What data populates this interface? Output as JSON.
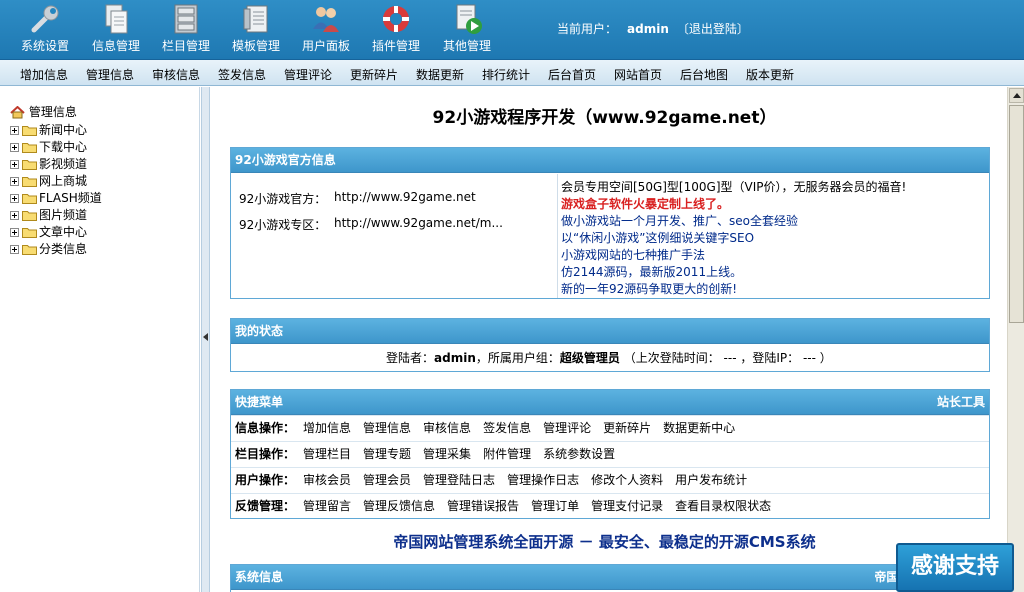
{
  "top_nav": {
    "items": [
      {
        "label": "系统设置",
        "icon": "wrench-icon"
      },
      {
        "label": "信息管理",
        "icon": "documents-icon"
      },
      {
        "label": "栏目管理",
        "icon": "cabinet-icon"
      },
      {
        "label": "模板管理",
        "icon": "template-icon"
      },
      {
        "label": "用户面板",
        "icon": "users-icon"
      },
      {
        "label": "插件管理",
        "icon": "lifebuoy-icon"
      },
      {
        "label": "其他管理",
        "icon": "play-document-icon"
      }
    ],
    "current_user_label": "当前用户：",
    "username": "admin",
    "logout": "〔退出登陆〕"
  },
  "sub_nav": [
    "增加信息",
    "管理信息",
    "审核信息",
    "签发信息",
    "管理评论",
    "更新碎片",
    "数据更新",
    "排行统计",
    "后台首页",
    "网站首页",
    "后台地图",
    "版本更新"
  ],
  "tree": {
    "root": "管理信息",
    "nodes": [
      "新闻中心",
      "下载中心",
      "影视频道",
      "网上商城",
      "FLASH频道",
      "图片频道",
      "文章中心",
      "分类信息"
    ]
  },
  "main": {
    "page_title": "92小游戏程序开发（www.92game.net）",
    "official": {
      "header": "92小游戏官方信息",
      "site_label": "92小游戏官方：",
      "site_url": "http://www.92game.net",
      "zone_label": "92小游戏专区：",
      "zone_url": "http://www.92game.net/m...",
      "news": [
        "会员专用空间[50G]型[100G]型（VIP价），无服务器会员的福音!",
        "游戏盒子软件火暴定制上线了。",
        "做小游戏站一个月开发、推广、seo全套经验",
        "以“休闲小游戏”这例细说关键字SEO",
        "小游戏网站的七种推广手法",
        "仿2144源码，最新版2011上线。",
        "新的一年92源码争取更大的创新!"
      ]
    },
    "status": {
      "header": "我的状态",
      "login_label": "登陆者：",
      "user": "admin",
      "group_label": "，所属用户组：",
      "group": "超级管理员",
      "last_login": "（上次登陆时间：  --- ，登陆IP：  --- ）"
    },
    "quick": {
      "header": "快捷菜单",
      "tools": "站长工具",
      "rows": [
        {
          "label": "信息操作：",
          "items": [
            "增加信息",
            "管理信息",
            "审核信息",
            "签发信息",
            "管理评论",
            "更新碎片",
            "数据更新中心"
          ]
        },
        {
          "label": "栏目操作：",
          "items": [
            "管理栏目",
            "管理专题",
            "管理采集",
            "附件管理",
            "系统参数设置"
          ]
        },
        {
          "label": "用户操作：",
          "items": [
            "审核会员",
            "管理会员",
            "管理登陆日志",
            "管理操作日志",
            "修改个人资料",
            "用户发布统计"
          ]
        },
        {
          "label": "反馈管理：",
          "items": [
            "管理留言",
            "管理反馈信息",
            "管理错误报告",
            "管理订单",
            "管理支付记录",
            "查看目录权限状态"
          ]
        }
      ]
    },
    "footer_slogan": "帝国网站管理系统全面开源  －  最安全、最稳定的开源CMS系统",
    "sysinfo": {
      "header": "系统信息",
      "right": "帝国MY"
    }
  },
  "thanks_badge": "感谢支持",
  "colors": {
    "top_bar": "#2486c0",
    "box_header": "#4ea6d8",
    "link_blue": "#002a8a",
    "hot_red": "#d92020"
  }
}
